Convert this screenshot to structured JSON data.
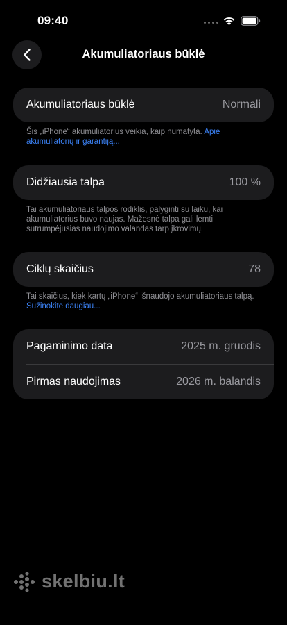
{
  "status_bar": {
    "time": "09:40"
  },
  "nav": {
    "title": "Akumuliatoriaus būklė"
  },
  "battery_health": {
    "label": "Akumuliatoriaus būklė",
    "value": "Normali",
    "footnote_text": "Šis „iPhone“ akumuliatorius veikia, kaip numatyta. ",
    "footnote_link": "Apie akumuliatorių ir garantiją..."
  },
  "max_capacity": {
    "label": "Didžiausia talpa",
    "value": "100 %",
    "footnote_text": "Tai akumuliatoriaus talpos rodiklis, palyginti su laiku, kai akumuliatorius buvo naujas. Mažesnė talpa gali lemti sutrumpėjusias naudojimo valandas tarp įkrovimų."
  },
  "cycle_count": {
    "label": "Ciklų skaičius",
    "value": "78",
    "footnote_text": "Tai skaičius, kiek kartų „iPhone“ išnaudojo akumuliatoriaus talpą. ",
    "footnote_link": "Sužinokite daugiau..."
  },
  "dates": {
    "manufacture_label": "Pagaminimo data",
    "manufacture_value": "2025 m. gruodis",
    "first_use_label": "Pirmas naudojimas",
    "first_use_value": "2026 m. balandis"
  },
  "watermark": {
    "text": "skelbiu.lt"
  },
  "colors": {
    "background": "#000000",
    "card": "#1c1c1e",
    "link": "#3b82f6",
    "secondary_text": "#8e8e93"
  }
}
